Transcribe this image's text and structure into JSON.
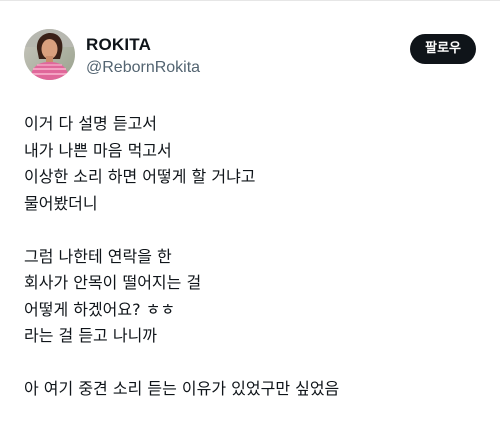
{
  "author": {
    "display_name": "ROKITA",
    "handle": "@RebornRokita"
  },
  "follow_button": {
    "label": "팔로우"
  },
  "tweet": {
    "paragraphs": [
      {
        "lines": [
          "이거 다 설명 듣고서",
          "내가 나쁜 마음 먹고서",
          "이상한 소리 하면 어떻게 할 거냐고",
          "물어봤더니"
        ]
      },
      {
        "lines": [
          "그럼 나한테 연락을 한",
          "회사가 안목이 떨어지는 걸",
          "어떻게 하겠어요? ㅎㅎ",
          "라는 걸 듣고 나니까"
        ]
      },
      {
        "lines": [
          "아 여기 중견 소리 듣는 이유가 있었구만 싶었음"
        ]
      }
    ]
  },
  "colors": {
    "text": "#0f1419",
    "secondary_text": "#536471",
    "button_bg": "#0f1419",
    "button_text": "#ffffff"
  },
  "icons": {
    "avatar": "profile-photo"
  }
}
